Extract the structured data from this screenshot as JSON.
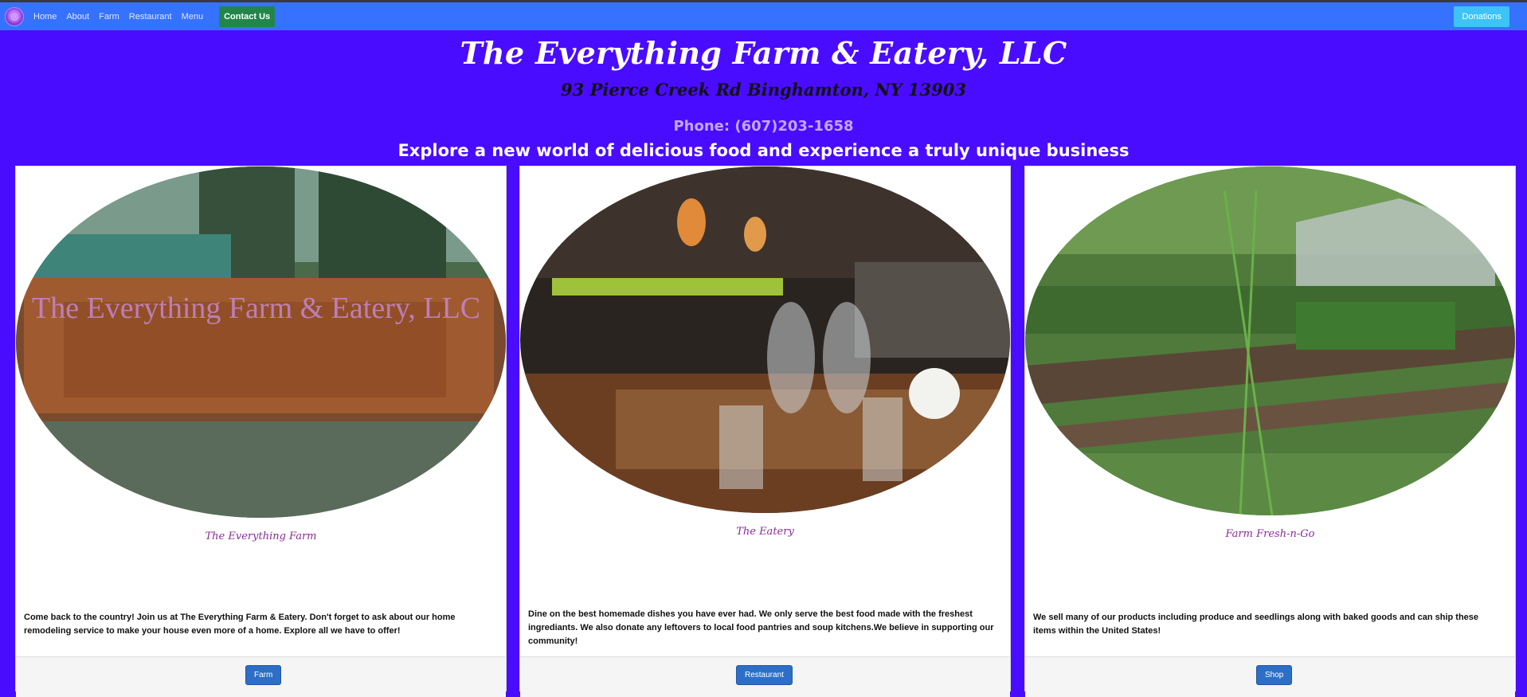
{
  "nav": {
    "items": [
      "Home",
      "About",
      "Farm",
      "Restaurant",
      "Menu"
    ],
    "contact_label": "Contact Us",
    "donations_label": "Donations"
  },
  "hero": {
    "title": "The Everything Farm & Eatery, LLC",
    "address": "93 Pierce Creek Rd Binghamton, NY 13903",
    "phone": "Phone: (607)203-1658",
    "tagline": "Explore a new world of delicious food and experience a truly unique business"
  },
  "cards": [
    {
      "title": "The Everything Farm",
      "text": "Come back to the country! Join us at The Everything Farm & Eatery. Don't forget to ask about our home remodeling service to make your house even more of a home. Explore all we have to offer!",
      "button": "Farm",
      "sign_text": "The Everything Farm & Eatery, LLC"
    },
    {
      "title": "The Eatery",
      "text": "Dine on the best homemade dishes you have ever had. We only serve the best food made with the freshest ingrediants. We also donate any leftovers to local food pantries and soup kitchens.We believe in supporting our community!",
      "button": "Restaurant"
    },
    {
      "title": "Farm Fresh-n-Go",
      "text": "We sell many of our products including produce and seedlings along with baked goods and can ship these items within the United States!",
      "button": "Shop"
    }
  ],
  "colors": {
    "page_bg": "#4a0cff",
    "navbar_bg": "#3672ff",
    "contact_bg": "#22864a",
    "donate_bg": "#3dc3f5",
    "card_title": "#8a2b9a",
    "button_bg": "#2d6fc7"
  }
}
